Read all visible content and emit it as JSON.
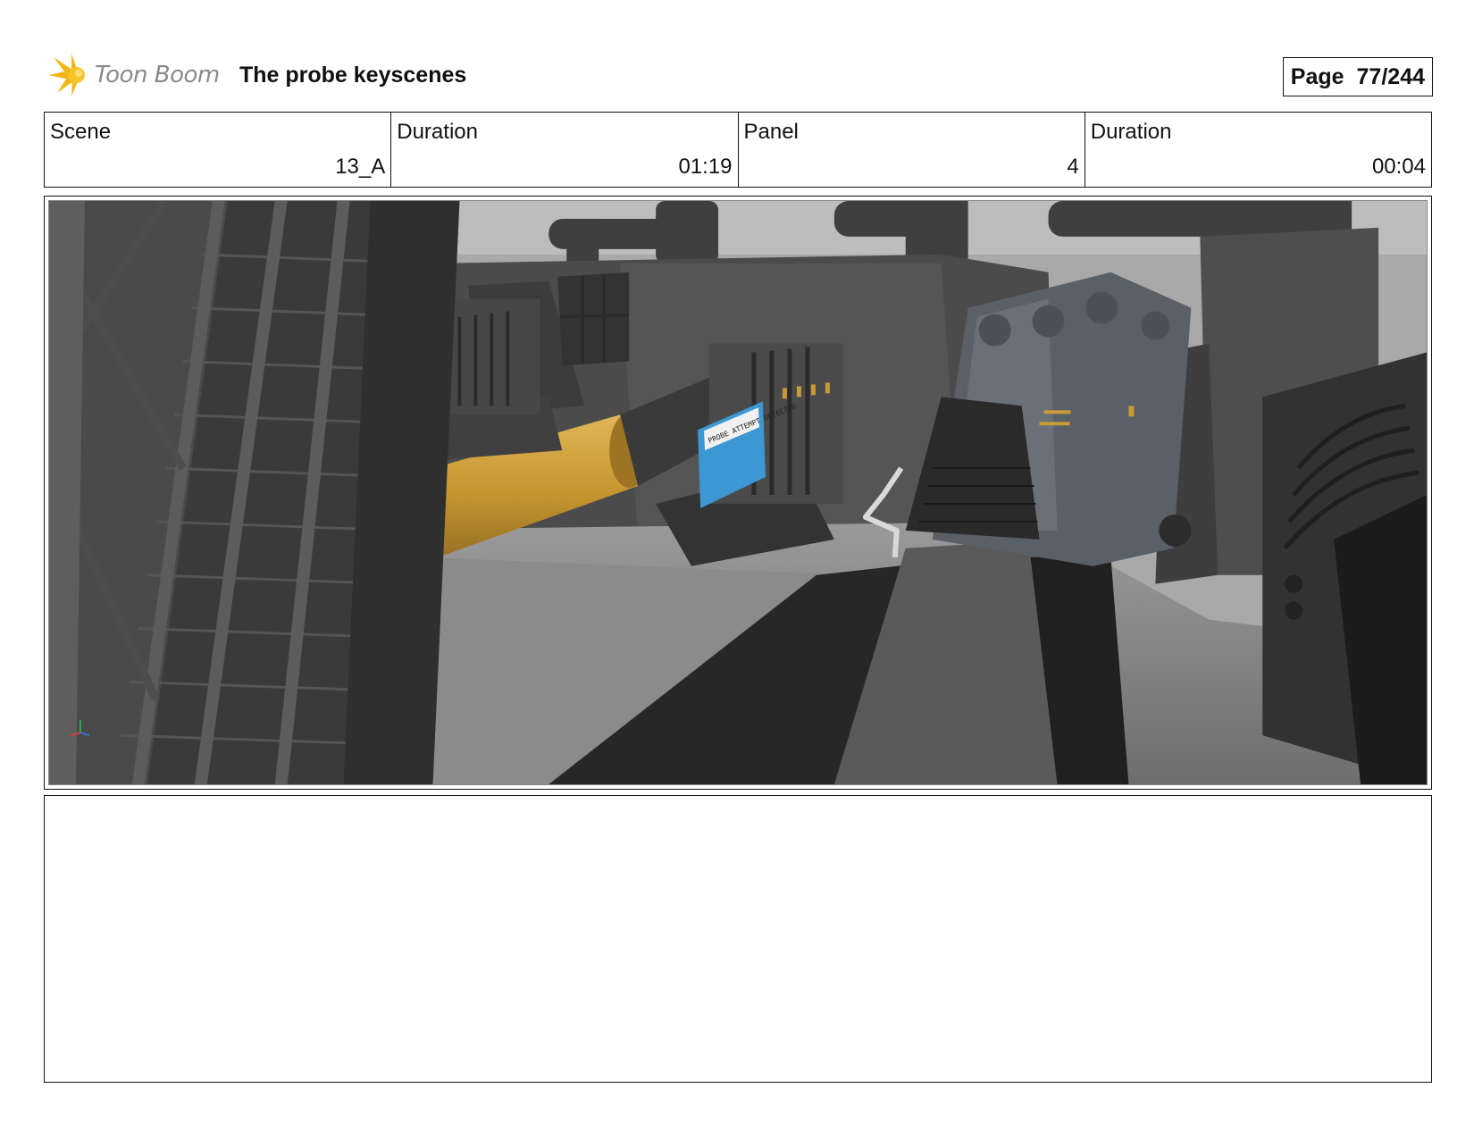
{
  "header": {
    "brand": "Toon Boom",
    "title": "The probe keyscenes",
    "page_label": "Page",
    "page_value": "77/244"
  },
  "info": {
    "scene_label": "Scene",
    "scene_value": "13_A",
    "scene_duration_label": "Duration",
    "scene_duration_value": "01:19",
    "panel_label": "Panel",
    "panel_value": "4",
    "panel_duration_label": "Duration",
    "panel_duration_value": "00:04"
  },
  "panel_image": {
    "sign_text": "PROBE ATTEMPT DETECTED",
    "colors": {
      "pipe": "#c99a35",
      "sign": "#3d97d2",
      "machinery": "#454545"
    }
  },
  "notes": {
    "text": ""
  }
}
